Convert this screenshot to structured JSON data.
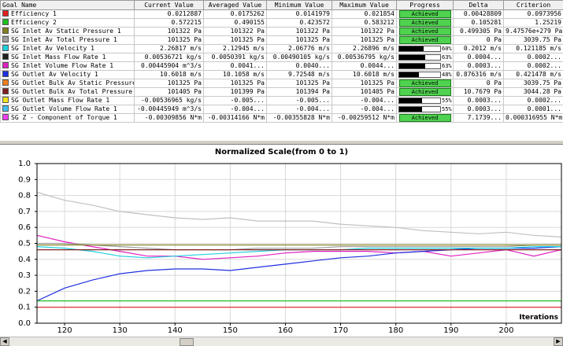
{
  "table": {
    "headers": [
      "Goal Name",
      "Current Value",
      "Averaged Value",
      "Minimum Value",
      "Maximum Value",
      "Progress",
      "Delta",
      "Criterion"
    ],
    "rows": [
      {
        "name": "Efficiency 1",
        "color": "#e02020",
        "current": "0.0212887",
        "averaged": "0.0175262",
        "minimum": "0.0141979",
        "maximum": "0.021854",
        "progress_type": "achieved",
        "progress_label": "Achieved",
        "progress_percent": 100,
        "delta": "0.00428809",
        "criterion": "0.0973956"
      },
      {
        "name": "Efficiency 2",
        "color": "#20c020",
        "current": "0.572215",
        "averaged": "0.490155",
        "minimum": "0.423572",
        "maximum": "0.583212",
        "progress_type": "achieved",
        "progress_label": "Achieved",
        "progress_percent": 100,
        "delta": "0.105281",
        "criterion": "1.25219"
      },
      {
        "name": "SG Inlet Av Static Pressure 1",
        "color": "#808020",
        "current": "101322 Pa",
        "averaged": "101322 Pa",
        "minimum": "101322 Pa",
        "maximum": "101322 Pa",
        "progress_type": "achieved",
        "progress_label": "Achieved",
        "progress_percent": 100,
        "delta": "0.499305 Pa",
        "criterion": "9.47576e+279 Pa"
      },
      {
        "name": "SG Inlet Av Total Pressure 1",
        "color": "#a0a0a0",
        "current": "101325 Pa",
        "averaged": "101325 Pa",
        "minimum": "101325 Pa",
        "maximum": "101325 Pa",
        "progress_type": "achieved",
        "progress_label": "Achieved",
        "progress_percent": 100,
        "delta": "0 Pa",
        "criterion": "3039.75 Pa"
      },
      {
        "name": "SG Inlet Av Velocity 1",
        "color": "#20d0e0",
        "current": "2.26817 m/s",
        "averaged": "2.12945 m/s",
        "minimum": "2.06776 m/s",
        "maximum": "2.26896 m/s",
        "progress_type": "bar",
        "progress_label": "60%",
        "progress_percent": 60,
        "delta": "0.2012 m/s",
        "criterion": "0.121185 m/s"
      },
      {
        "name": "SG Inlet Mass Flow Rate 1",
        "color": "#202020",
        "current": "0.00536721 kg/s",
        "averaged": "0.0050391 kg/s",
        "minimum": "0.00490105 kg/s",
        "maximum": "0.00536795 kg/s",
        "progress_type": "bar",
        "progress_label": "63%",
        "progress_percent": 63,
        "delta": "0.0004...",
        "criterion": "0.0002..."
      },
      {
        "name": "SG Inlet Volume Flow Rate 1",
        "color": "#e020c0",
        "current": "0.00445904 m^3/s",
        "averaged": "0.0041...",
        "minimum": "0.0040...",
        "maximum": "0.0044...",
        "progress_type": "bar",
        "progress_label": "63%",
        "progress_percent": 63,
        "delta": "0.0003...",
        "criterion": "0.0002..."
      },
      {
        "name": "SG Outlet Av Velocity 1",
        "color": "#2030e0",
        "current": "10.6018 m/s",
        "averaged": "10.1058 m/s",
        "minimum": "9.72548 m/s",
        "maximum": "10.6018 m/s",
        "progress_type": "bar",
        "progress_label": "48%",
        "progress_percent": 48,
        "delta": "0.876316 m/s",
        "criterion": "0.421478 m/s"
      },
      {
        "name": "SG Outlet Bulk Av Static Pressure 1",
        "color": "#f08020",
        "current": "101325 Pa",
        "averaged": "101325 Pa",
        "minimum": "101325 Pa",
        "maximum": "101325 Pa",
        "progress_type": "achieved",
        "progress_label": "Achieved",
        "progress_percent": 100,
        "delta": "0 Pa",
        "criterion": "3039.75 Pa"
      },
      {
        "name": "SG Outlet Bulk Av Total Pressure 1",
        "color": "#802020",
        "current": "101405 Pa",
        "averaged": "101399 Pa",
        "minimum": "101394 Pa",
        "maximum": "101405 Pa",
        "progress_type": "achieved",
        "progress_label": "Achieved",
        "progress_percent": 100,
        "delta": "10.7679 Pa",
        "criterion": "3044.28 Pa"
      },
      {
        "name": "SG Outlet Mass Flow Rate 1",
        "color": "#f0e020",
        "current": "-0.00536965 kg/s",
        "averaged": "-0.005...",
        "minimum": "-0.005...",
        "maximum": "-0.004...",
        "progress_type": "bar",
        "progress_label": "55%",
        "progress_percent": 55,
        "delta": "0.0003...",
        "criterion": "0.0002..."
      },
      {
        "name": "SG Outlet Volume Flow Rate 1",
        "color": "#40c0f0",
        "current": "-0.00445949 m^3/s",
        "averaged": "-0.004...",
        "minimum": "-0.004...",
        "maximum": "-0.004...",
        "progress_type": "bar",
        "progress_label": "55%",
        "progress_percent": 55,
        "delta": "0.0003...",
        "criterion": "0.0001..."
      },
      {
        "name": "SG Z - Component of Torque 1",
        "color": "#f040f0",
        "current": "-0.00309856 N*m",
        "averaged": "-0.00314166 N*m",
        "minimum": "-0.00355828 N*m",
        "maximum": "-0.00259512 N*m",
        "progress_type": "achieved",
        "progress_label": "Achieved",
        "progress_percent": 100,
        "delta": "7.1739...",
        "criterion": "0.000316955 N*m"
      }
    ]
  },
  "chart_data": {
    "type": "line",
    "title": "Normalized Scale(from 0 to 1)",
    "xlabel": "Iterations",
    "ylabel": "",
    "xlim": [
      115,
      210
    ],
    "ylim": [
      0,
      1
    ],
    "x_ticks": [
      "120",
      "130",
      "140",
      "150",
      "160",
      "170",
      "180",
      "190",
      "200"
    ],
    "y_ticks": [
      "0.0",
      "0.1",
      "0.2",
      "0.3",
      "0.4",
      "0.5",
      "0.6",
      "0.7",
      "0.8",
      "0.9",
      "1.0"
    ],
    "grid": true,
    "x": [
      115,
      120,
      125,
      130,
      135,
      140,
      145,
      150,
      155,
      160,
      165,
      170,
      175,
      180,
      185,
      190,
      195,
      200,
      205,
      210
    ],
    "series": [
      {
        "color": "#c0c0c0",
        "values": [
          0.82,
          0.77,
          0.74,
          0.7,
          0.68,
          0.66,
          0.65,
          0.66,
          0.64,
          0.64,
          0.64,
          0.62,
          0.61,
          0.6,
          0.58,
          0.57,
          0.56,
          0.57,
          0.55,
          0.54
        ]
      },
      {
        "color": "#e020c0",
        "values": [
          0.55,
          0.51,
          0.48,
          0.45,
          0.42,
          0.42,
          0.4,
          0.41,
          0.42,
          0.44,
          0.45,
          0.45,
          0.45,
          0.44,
          0.45,
          0.42,
          0.44,
          0.46,
          0.42,
          0.46
        ]
      },
      {
        "color": "#2030e0",
        "values": [
          0.14,
          0.22,
          0.27,
          0.31,
          0.33,
          0.34,
          0.34,
          0.33,
          0.35,
          0.37,
          0.39,
          0.41,
          0.42,
          0.44,
          0.45,
          0.46,
          0.47,
          0.47,
          0.47,
          0.48
        ]
      },
      {
        "color": "#20d0e0",
        "values": [
          0.48,
          0.47,
          0.45,
          0.42,
          0.41,
          0.42,
          0.43,
          0.44,
          0.45,
          0.46,
          0.46,
          0.46,
          0.47,
          0.47,
          0.47,
          0.47,
          0.47,
          0.47,
          0.48,
          0.48
        ]
      },
      {
        "color": "#a0a0a0",
        "values": [
          0.5,
          0.5,
          0.49,
          0.48,
          0.47,
          0.46,
          0.46,
          0.46,
          0.47,
          0.47,
          0.47,
          0.48,
          0.48,
          0.48,
          0.48,
          0.48,
          0.48,
          0.48,
          0.49,
          0.49
        ]
      },
      {
        "color": "#802020",
        "values": [
          0.46,
          0.46,
          0.46,
          0.46,
          0.46,
          0.46,
          0.46,
          0.46,
          0.46,
          0.46,
          0.46,
          0.46,
          0.46,
          0.46,
          0.46,
          0.46,
          0.46,
          0.46,
          0.46,
          0.46
        ]
      },
      {
        "color": "#808020",
        "values": [
          0.49,
          0.49,
          0.49,
          0.49,
          0.49,
          0.49,
          0.49,
          0.49,
          0.49,
          0.49,
          0.49,
          0.49,
          0.49,
          0.49,
          0.49,
          0.49,
          0.49,
          0.49,
          0.49,
          0.49
        ]
      },
      {
        "color": "#20c020",
        "values": [
          0.14,
          0.14,
          0.14,
          0.14,
          0.14,
          0.14,
          0.14,
          0.14,
          0.14,
          0.14,
          0.14,
          0.14,
          0.14,
          0.14,
          0.14,
          0.14,
          0.14,
          0.14,
          0.14,
          0.14
        ]
      },
      {
        "color": "#e02020",
        "values": [
          0.1,
          0.1,
          0.1,
          0.1,
          0.1,
          0.1,
          0.1,
          0.1,
          0.1,
          0.1,
          0.1,
          0.1,
          0.1,
          0.1,
          0.1,
          0.1,
          0.1,
          0.1,
          0.1,
          0.1
        ]
      }
    ]
  },
  "scrollbar": {
    "left_icon": "scroll-left-arrow",
    "right_icon": "scroll-right-arrow",
    "left_glyph": "◀",
    "right_glyph": "▶"
  }
}
